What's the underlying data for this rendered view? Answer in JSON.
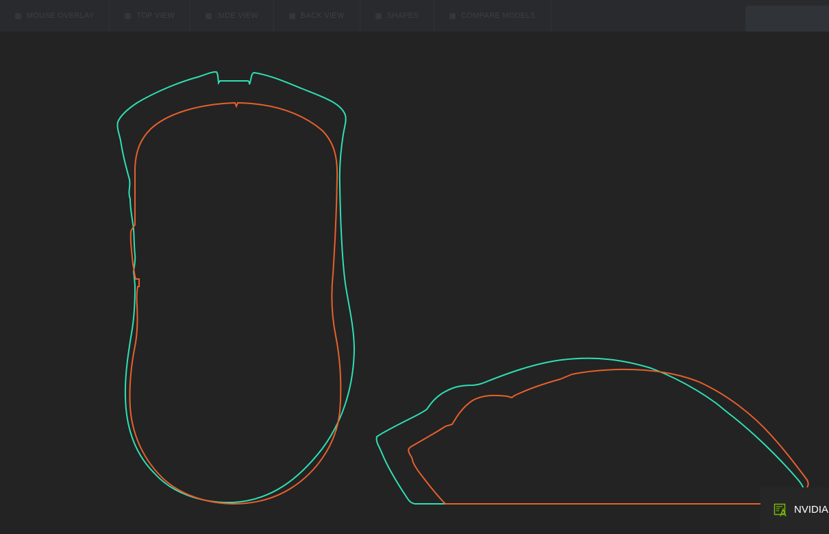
{
  "topbar": {
    "tabs": [
      {
        "label": "MOUSE OVERLAY"
      },
      {
        "label": "TOP VIEW"
      },
      {
        "label": "SIDE VIEW"
      },
      {
        "label": "BACK VIEW"
      },
      {
        "label": "SHAPES"
      },
      {
        "label": "COMPARE MODELS"
      }
    ]
  },
  "colors": {
    "background": "#232323",
    "outline_a": "#2fe0b4",
    "outline_b": "#e8602c"
  },
  "overlay": {
    "label": "NVIDIA",
    "icon": "nvidia-overlay-icon"
  }
}
